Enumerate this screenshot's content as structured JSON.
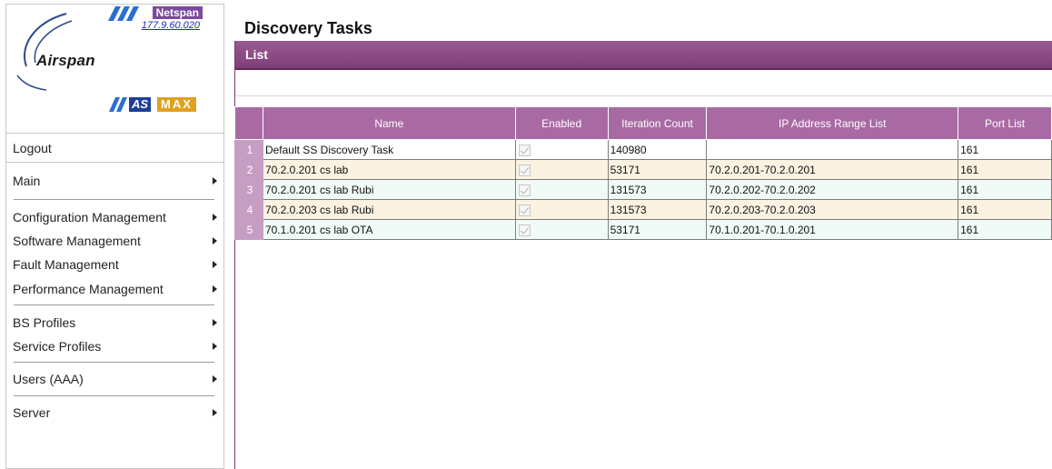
{
  "brand": {
    "product": "Netspan",
    "version": "177.9.60.020",
    "company": "Airspan",
    "badge_as": "AS",
    "badge_max": "MAX"
  },
  "colors": {
    "accent": "#7e3e77",
    "header": "#a96aa4",
    "row_number": "#c79ec3",
    "link": "#1b2fb8"
  },
  "menu": {
    "logout": "Logout",
    "main": "Main",
    "configuration": "Configuration Management",
    "software": "Software Management",
    "fault": "Fault Management",
    "performance": "Performance Management",
    "bs_profiles": "BS Profiles",
    "service_profiles": "Service Profiles",
    "users": "Users (AAA)",
    "server": "Server"
  },
  "page": {
    "title": "Discovery Tasks",
    "section": "List"
  },
  "table": {
    "columns": [
      "Name",
      "Enabled",
      "Iteration Count",
      "IP Address Range List",
      "Port List"
    ],
    "rows": [
      {
        "num": "1",
        "name": "Default SS Discovery Task",
        "enabled": true,
        "iterations": "140980",
        "ip_range": "",
        "ports": "161"
      },
      {
        "num": "2",
        "name": "70.2.0.201 cs lab",
        "enabled": true,
        "iterations": "53171",
        "ip_range": "70.2.0.201-70.2.0.201",
        "ports": "161"
      },
      {
        "num": "3",
        "name": "70.2.0.201 cs lab Rubi",
        "enabled": true,
        "iterations": "131573",
        "ip_range": "70.2.0.202-70.2.0.202",
        "ports": "161"
      },
      {
        "num": "4",
        "name": "70.2.0.203 cs lab Rubi",
        "enabled": true,
        "iterations": "131573",
        "ip_range": "70.2.0.203-70.2.0.203",
        "ports": "161"
      },
      {
        "num": "5",
        "name": "70.1.0.201 cs lab OTA",
        "enabled": true,
        "iterations": "53171",
        "ip_range": "70.1.0.201-70.1.0.201",
        "ports": "161"
      }
    ]
  }
}
